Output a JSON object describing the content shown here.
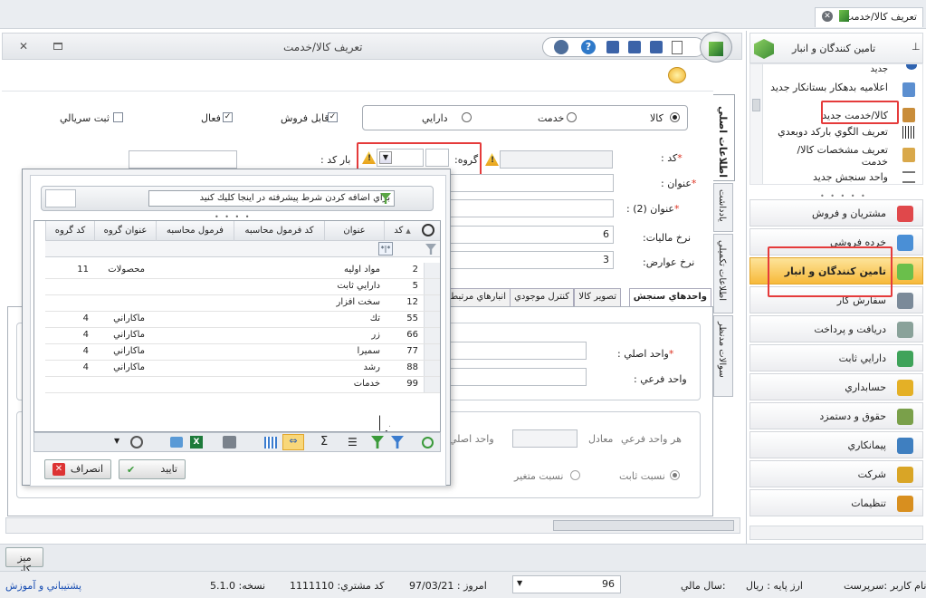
{
  "topbar": {
    "tab_label": "تعريف كالا/خدمت"
  },
  "window": {
    "title": "تعريف كالا/خدمت"
  },
  "checkboxes": {
    "serial": "ثبت سريالي",
    "active": "فعال",
    "saleable": "قابل فروش"
  },
  "item_type": {
    "options": [
      "كالا",
      "خدمت",
      "دارايي"
    ],
    "selected": "كالا"
  },
  "fields": {
    "code_label": "كد :",
    "barcode_label": "بار كد :",
    "group_label": "گروه:",
    "title_label": "عنوان :",
    "title2_label": "عنوان (2) :",
    "tax_label": "نرخ ماليات:",
    "tax_value": "6",
    "duty_label": "نرخ عوارض:",
    "duty_value": "3",
    "main_unit_label": "واحد اصلي :",
    "sub_unit_label": "واحد فرعي :",
    "each_sub_unit": "هر واحد فرعي",
    "equivalent": "معادل",
    "main_unit_short": "واحد اصلي",
    "fixed_ratio": "نسبت ثابت",
    "variable_ratio": "نسبت متغير"
  },
  "vertical_tabs": [
    "اطلاعات اصلي",
    "يادداشت",
    "اطلاعات تكميلي",
    "سوالات مدنظر"
  ],
  "subtabs": [
    "واحدهاي سنجش",
    "تصوير كالا",
    "كنترل موجودي",
    "انبارهاي مرتبط"
  ],
  "popup": {
    "filter_text": "براي اضافه كردن شرط پيشرفته در اينجا كليك كنيد",
    "columns": [
      "كد",
      "عنوان",
      "كد فرمول محاسبه",
      "فرمول محاسبه",
      "عنوان گروه",
      "كد گروه"
    ],
    "filter_symbol": "*|*",
    "rows": [
      {
        "code": "2",
        "title": "مواد اوليه",
        "group_title": "محصولات",
        "group_code": "11"
      },
      {
        "code": "5",
        "title": "دارايي ثابت",
        "group_title": "",
        "group_code": ""
      },
      {
        "code": "12",
        "title": "سخت افزار",
        "group_title": "",
        "group_code": ""
      },
      {
        "code": "55",
        "title": "تك",
        "group_title": "ماكاراني",
        "group_code": "4"
      },
      {
        "code": "66",
        "title": "زر",
        "group_title": "ماكاراني",
        "group_code": "4"
      },
      {
        "code": "77",
        "title": "سميرا",
        "group_title": "ماكاراني",
        "group_code": "4"
      },
      {
        "code": "88",
        "title": "رشد",
        "group_title": "ماكاراني",
        "group_code": "4"
      },
      {
        "code": "99",
        "title": "خدمات",
        "group_title": "",
        "group_code": ""
      }
    ],
    "ok_label": "تاييد",
    "cancel_label": "انصراف"
  },
  "side": {
    "header": "تامين كنندگان و انبار",
    "items": [
      "جديد",
      "اعلاميه بدهكار بستانكار جديد",
      "كالا/خدمت جديد",
      "تعريف الگوي باركد دوبعدي",
      "تعريف مشخصات كالا/خدمت",
      "واحد سنجش جديد"
    ],
    "nav": [
      {
        "label": "مشتريان و فروش",
        "color": "#e0484b"
      },
      {
        "label": "خرده فروشي",
        "color": "#4a8fd6"
      },
      {
        "label": "تامين كنندگان و انبار",
        "color": "#6abf4b"
      },
      {
        "label": "سفارش كار",
        "color": "#7b8a99"
      },
      {
        "label": "دريافت و پرداخت",
        "color": "#8aa29a"
      },
      {
        "label": "دارايي ثابت",
        "color": "#3fa35a"
      },
      {
        "label": "حسابداري",
        "color": "#e4b026"
      },
      {
        "label": "حقوق و دستمزد",
        "color": "#7aa04a"
      },
      {
        "label": "پيمانكاري",
        "color": "#3f7fc0"
      },
      {
        "label": "شركت",
        "color": "#d9a526"
      },
      {
        "label": "تنظيمات",
        "color": "#d88f1f"
      }
    ]
  },
  "taskbar": {
    "desk": "ميز كار"
  },
  "status": {
    "user": "نام كاربر :سرپرست",
    "currency": "ارز پايه : ريال",
    "fiscal_year": "سال مالي:",
    "year_value": "96",
    "today": "امروز : 97/03/21",
    "customer_code": "كد مشتري: 1111110",
    "version": "نسخه: 5.1.0",
    "support": "پشتيباني و آموزش"
  },
  "colors": {
    "accent": "#f5b83c",
    "highlight": "#e53b3b",
    "nav_active": "#fbc94f"
  }
}
